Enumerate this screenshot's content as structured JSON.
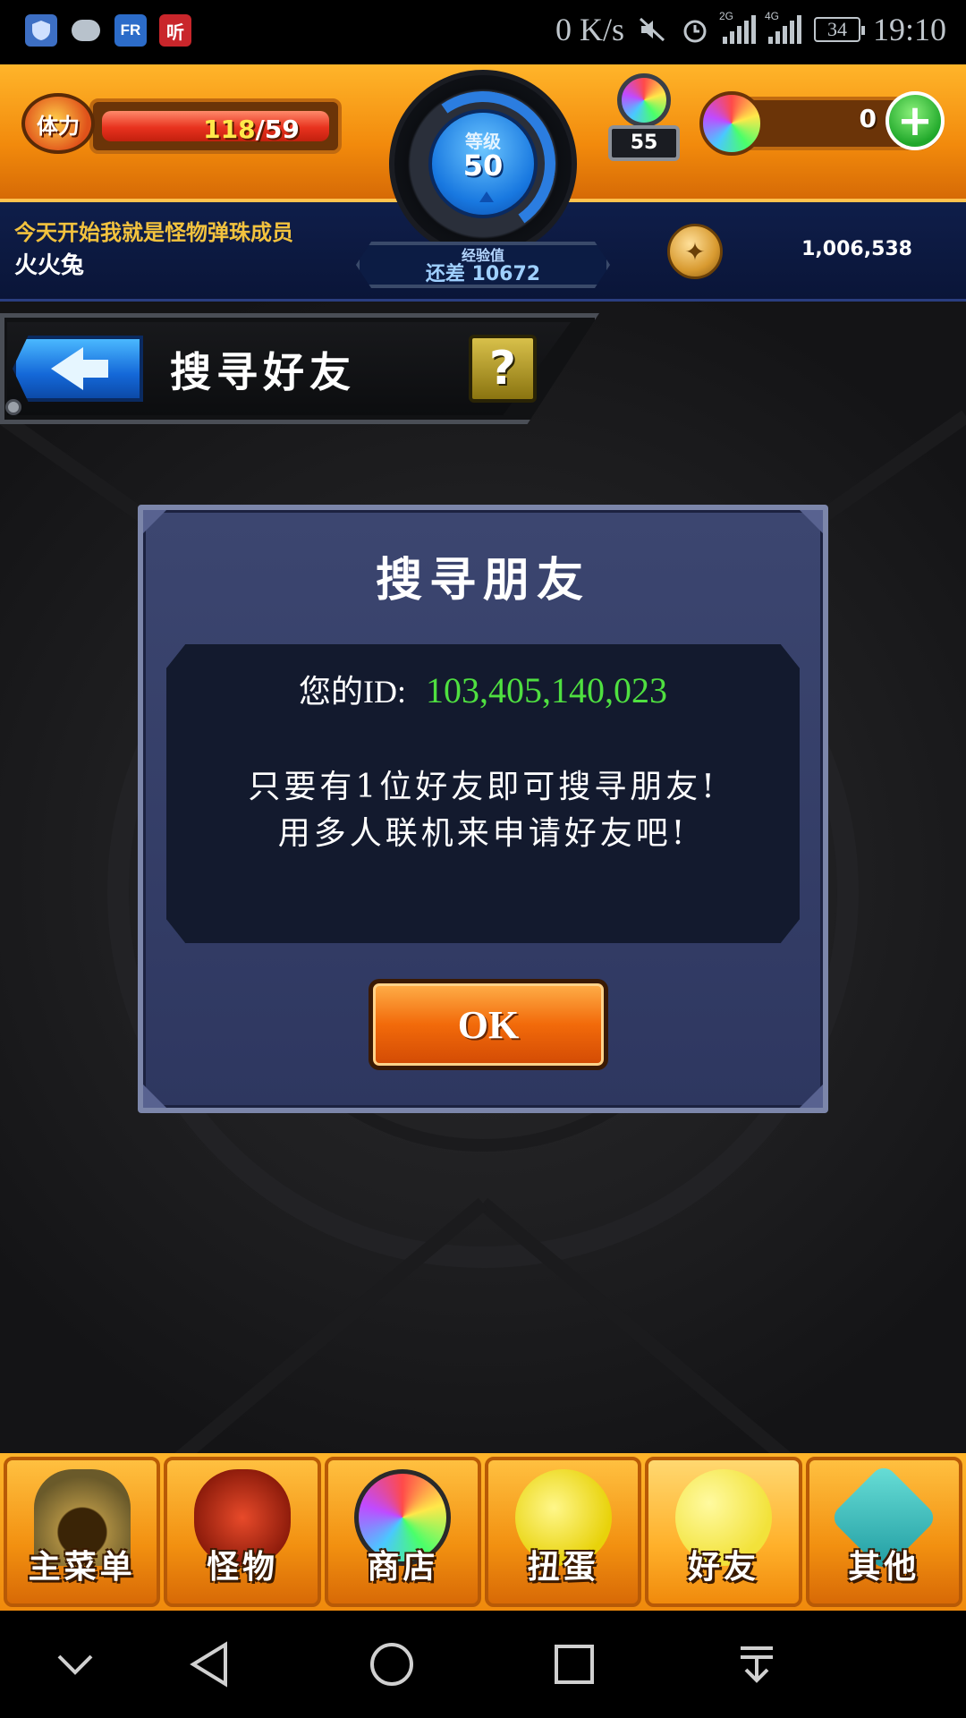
{
  "status_bar": {
    "speed": "0 K/s",
    "signal1_tag": "2G",
    "signal2_tag": "4G",
    "battery": "34",
    "time": "19:10",
    "app_fr": "FR",
    "app_ting": "听"
  },
  "header": {
    "stamina_icon_label": "体力",
    "stamina_current": "118",
    "stamina_max": "/59",
    "level_label": "等级",
    "level_value": "50",
    "exp_label": "经验值",
    "exp_remaining": "还差 10672",
    "gem_box_count": "55",
    "orb_count": "0",
    "player_title": "今天开始我就是怪物弹珠成员",
    "player_name": "火火兔",
    "coins": "1,006,538"
  },
  "page": {
    "title": "搜寻好友",
    "help": "?"
  },
  "dialog": {
    "title": "搜寻朋友",
    "id_label": "您的ID:",
    "id_value": "103,405,140,023",
    "message_line1": "只要有1位好友即可搜寻朋友!",
    "message_line2": "用多人联机来申请好友吧!",
    "ok_label": "OK"
  },
  "bottom_nav": {
    "items": [
      {
        "label": "主菜单",
        "icon": "gate-icon"
      },
      {
        "label": "怪物",
        "icon": "monster-icon"
      },
      {
        "label": "商店",
        "icon": "orb-icon"
      },
      {
        "label": "扭蛋",
        "icon": "egg-icon"
      },
      {
        "label": "好友",
        "icon": "friends-icon"
      },
      {
        "label": "其他",
        "icon": "question-icon"
      }
    ],
    "active_index": 4
  },
  "colors": {
    "accent_orange": "#f28a0c",
    "id_green": "#4fe040",
    "dialog_bg": "#3c4670"
  }
}
